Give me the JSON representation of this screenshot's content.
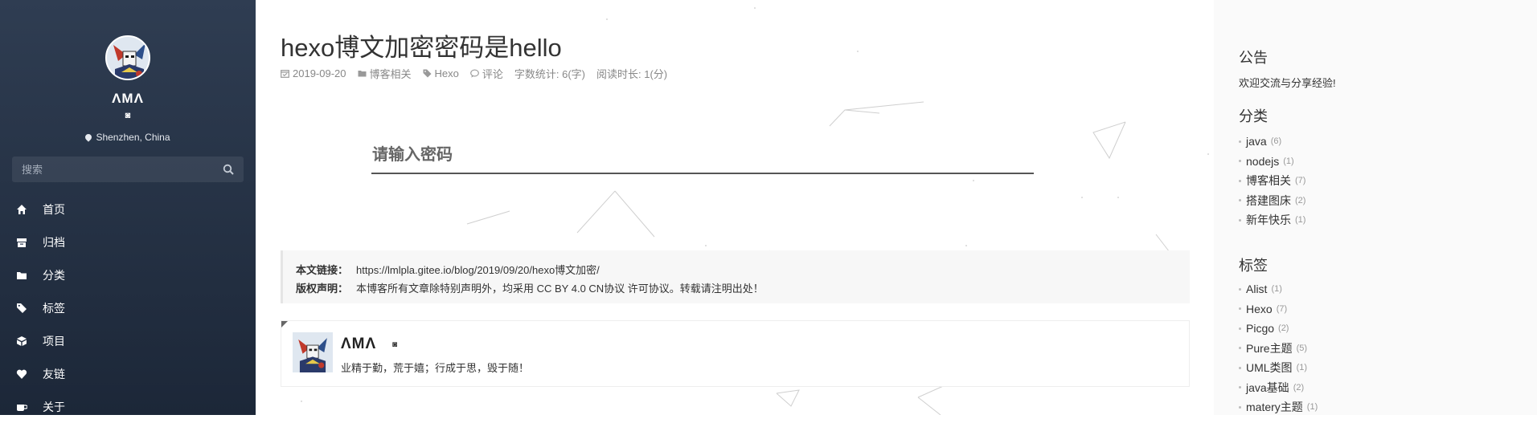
{
  "sidebar": {
    "site_name": "ΛMΛ",
    "site_mark": "◙",
    "location": "Shenzhen, China",
    "search_placeholder": "搜索",
    "nav": [
      {
        "label": "首页",
        "icon": "home-icon"
      },
      {
        "label": "归档",
        "icon": "archive-icon"
      },
      {
        "label": "分类",
        "icon": "folder-icon"
      },
      {
        "label": "标签",
        "icon": "tags-icon"
      },
      {
        "label": "项目",
        "icon": "cube-icon"
      },
      {
        "label": "友链",
        "icon": "heart-icon"
      },
      {
        "label": "关于",
        "icon": "coffee-icon"
      }
    ]
  },
  "post": {
    "title": "hexo博文加密密码是hello",
    "date": "2019-09-20",
    "category": "博客相关",
    "tag": "Hexo",
    "comments": "评论",
    "word_count": "字数统计: 6(字)",
    "read_time": "阅读时长: 1(分)",
    "password_prompt": "请输入密码"
  },
  "copyright": {
    "link_label": "本文链接：",
    "link_value": "https://lmlpla.gitee.io/blog/2019/09/20/hexo博文加密/",
    "license_label": "版权声明：",
    "license_value": "本博客所有文章除特别声明外，均采用 CC BY 4.0 CN协议 许可协议。转载请注明出处！"
  },
  "author": {
    "name": "ΛMΛ",
    "mark": "◙",
    "motto": "业精于勤，荒于嬉；行成于思，毁于随！"
  },
  "right": {
    "notice_title": "公告",
    "notice_text": "欢迎交流与分享经验!",
    "categories_title": "分类",
    "categories": [
      {
        "name": "java",
        "count": "(6)"
      },
      {
        "name": "nodejs",
        "count": "(1)"
      },
      {
        "name": "博客相关",
        "count": "(7)"
      },
      {
        "name": "搭建图床",
        "count": "(2)"
      },
      {
        "name": "新年快乐",
        "count": "(1)"
      }
    ],
    "tags_title": "标签",
    "tags": [
      {
        "name": "Alist",
        "count": "(1)"
      },
      {
        "name": "Hexo",
        "count": "(7)"
      },
      {
        "name": "Picgo",
        "count": "(2)"
      },
      {
        "name": "Pure主题",
        "count": "(5)"
      },
      {
        "name": "UML类图",
        "count": "(1)"
      },
      {
        "name": "java基础",
        "count": "(2)"
      },
      {
        "name": "matery主题",
        "count": "(1)"
      }
    ]
  },
  "colors": {
    "sidebar_top": "#2f3d52",
    "sidebar_bottom": "#1c2738",
    "right_bg": "#fafafa",
    "meta_text": "#888888"
  }
}
